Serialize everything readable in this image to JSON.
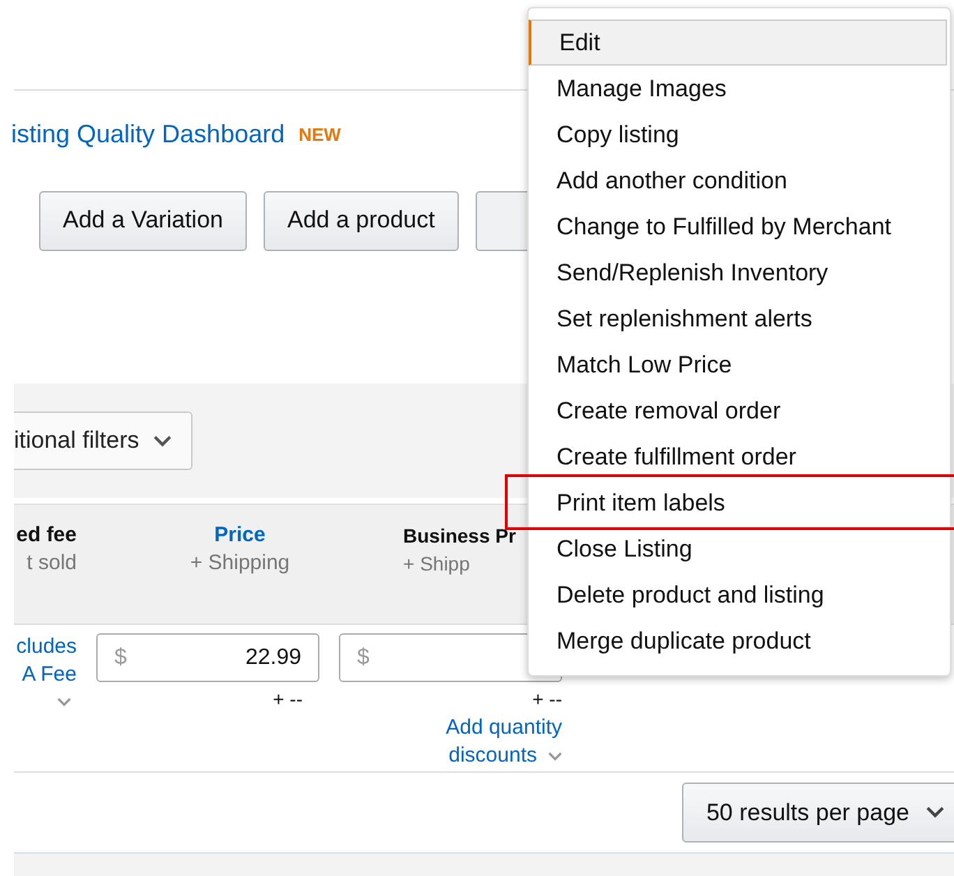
{
  "dashboard_link": {
    "label": "isting Quality Dashboard",
    "badge": "NEW"
  },
  "actions": [
    "Add a Variation",
    "Add a product"
  ],
  "filters_button": {
    "label": "itional filters"
  },
  "table": {
    "columns": [
      {
        "kind": "plain",
        "lines": [
          "ed fee",
          "t sold"
        ]
      },
      {
        "kind": "sortable",
        "lines": [
          "Price",
          "+ Shipping"
        ]
      },
      {
        "kind": "plain",
        "lines": [
          "Business Pr",
          "+ Shipp"
        ]
      }
    ],
    "row": {
      "fee_link": [
        "cludes",
        "A Fee"
      ],
      "price": {
        "currency": "$",
        "value": "22.99",
        "shipping": "+ --"
      },
      "business_price": {
        "currency": "$",
        "shipping": "+ --",
        "link": [
          "Add quantity",
          "discounts"
        ]
      }
    }
  },
  "per_page": {
    "label": "50 results per page"
  },
  "menu": {
    "items": [
      {
        "label": "Edit",
        "selected": true,
        "highlighted": false
      },
      {
        "label": "Manage Images",
        "selected": false,
        "highlighted": false
      },
      {
        "label": "Copy listing",
        "selected": false,
        "highlighted": false
      },
      {
        "label": "Add another condition",
        "selected": false,
        "highlighted": false
      },
      {
        "label": "Change to Fulfilled by Merchant",
        "selected": false,
        "highlighted": false
      },
      {
        "label": "Send/Replenish Inventory",
        "selected": false,
        "highlighted": false
      },
      {
        "label": "Set replenishment alerts",
        "selected": false,
        "highlighted": false
      },
      {
        "label": "Match Low Price",
        "selected": false,
        "highlighted": false
      },
      {
        "label": "Create removal order",
        "selected": false,
        "highlighted": false
      },
      {
        "label": "Create fulfillment order",
        "selected": false,
        "highlighted": false
      },
      {
        "label": "Print item labels",
        "selected": false,
        "highlighted": true
      },
      {
        "label": "Close Listing",
        "selected": false,
        "highlighted": false
      },
      {
        "label": "Delete product and listing",
        "selected": false,
        "highlighted": false
      },
      {
        "label": "Merge duplicate product",
        "selected": false,
        "highlighted": false
      }
    ]
  }
}
